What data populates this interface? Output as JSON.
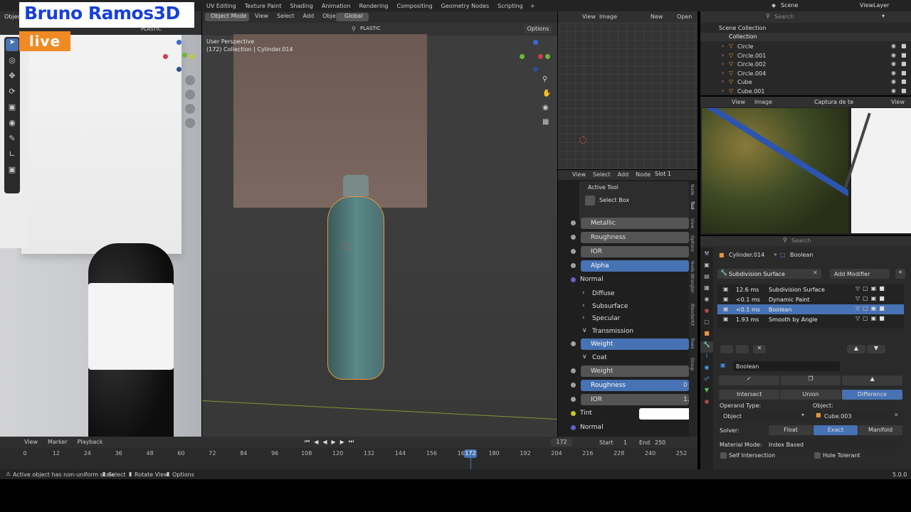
{
  "overlay": {
    "brand": "Bruno Ramos3D",
    "live": "live"
  },
  "topbar": {
    "workspaces": [
      "UV Editing",
      "Texture Paint",
      "Shading",
      "Animation",
      "Rendering",
      "Compositing",
      "Geometry Nodes",
      "Scripting"
    ],
    "add_tab": "+",
    "scene": "Scene",
    "view_layer": "ViewLayer"
  },
  "left_viewport": {
    "search_value": "PLASTIC",
    "tab": "Objec"
  },
  "main_viewport": {
    "mode": "Object Mode",
    "menus": [
      "View",
      "Select",
      "Add",
      "Object"
    ],
    "orientation": "Global",
    "search_value": "PLASTIC",
    "options": "Options",
    "info_line1": "User Perspective",
    "info_line2": "(172) Collection | Cylinder.014"
  },
  "image_editor_top": {
    "menus": [
      "View",
      "Image"
    ],
    "new": "New",
    "open": "Open"
  },
  "node_editor": {
    "menus": [
      "View",
      "Select",
      "Add",
      "Node"
    ],
    "slot": "Slot 1",
    "active_tool_title": "Active Tool",
    "active_tool_name": "Select Box",
    "tabs": [
      "Node",
      "Tool",
      "View",
      "Options",
      "Node Wrangler",
      "BlenderKit",
      "Trees",
      "Group"
    ],
    "rows": [
      {
        "label": "Metallic",
        "type": "field",
        "socket": "#a1a1a1"
      },
      {
        "label": "Roughness",
        "type": "field",
        "socket": "#a1a1a1"
      },
      {
        "label": "IOR",
        "type": "field",
        "socket": "#a1a1a1"
      },
      {
        "label": "Alpha",
        "type": "blue",
        "socket": "#a1a1a1"
      },
      {
        "label": "Normal",
        "type": "plain",
        "socket": "#6363c7"
      },
      {
        "label": "Diffuse",
        "type": "section"
      },
      {
        "label": "Subsurface",
        "type": "section"
      },
      {
        "label": "Specular",
        "type": "section"
      },
      {
        "label": "Transmission",
        "type": "section-open"
      },
      {
        "label": "Weight",
        "type": "blue",
        "socket": "#a1a1a1"
      },
      {
        "label": "Coat",
        "type": "section-open"
      },
      {
        "label": "Weight",
        "type": "field",
        "socket": "#a1a1a1"
      },
      {
        "label": "Roughness",
        "type": "blue",
        "socket": "#a1a1a1",
        "value": "0"
      },
      {
        "label": "IOR",
        "type": "field",
        "socket": "#a1a1a1",
        "value": "1."
      },
      {
        "label": "Tint",
        "type": "color",
        "socket": "#c7c729"
      },
      {
        "label": "Normal",
        "type": "plain",
        "socket": "#6363c7"
      }
    ]
  },
  "outliner": {
    "search_placeholder": "Search",
    "scene_collection": "Scene Collection",
    "collection": "Collection",
    "items": [
      "Circle",
      "Circle.001",
      "Circle.002",
      "Circle.004",
      "Cube",
      "Cube.001"
    ]
  },
  "image_editor_bottom": {
    "menus": [
      "View",
      "Image"
    ],
    "image_name": "Captura de te",
    "view2": "View"
  },
  "properties": {
    "search_placeholder": "Search",
    "object": "Cylinder.014",
    "modifier_context": "Boolean",
    "subdivision_title": "Subdivision Surface",
    "add_modifier": "Add Modifier",
    "modifiers": [
      {
        "time": "12.6 ms",
        "name": "Subdivision Surface",
        "selected": false
      },
      {
        "time": "<0.1 ms",
        "name": "Dynamic Paint",
        "selected": false
      },
      {
        "time": "<0.1 ms",
        "name": "Boolean",
        "selected": true
      },
      {
        "time": "1.93 ms",
        "name": "Smooth by Angle",
        "selected": false
      }
    ],
    "boolean_name": "Boolean",
    "ops": [
      "Intersect",
      "Union",
      "Difference"
    ],
    "operand_type_label": "Operand Type:",
    "operand_type_value": "Object",
    "object_label": "Object:",
    "object_value": "Cube.003",
    "solver_label": "Solver:",
    "solvers": [
      "Float",
      "Exact",
      "Manifold"
    ],
    "material_mode_label": "Material Mode:",
    "material_mode_value": "Index Based",
    "self_intersection": "Self Intersection",
    "hole_tolerant": "Hole Tolerant"
  },
  "timeline": {
    "menus": [
      "View",
      "Marker",
      "Playback"
    ],
    "current_frame": "172",
    "start_label": "Start",
    "start": "1",
    "end_label": "End",
    "end": "250",
    "ticks": [
      "0",
      "12",
      "24",
      "36",
      "48",
      "60",
      "72",
      "84",
      "96",
      "108",
      "120",
      "132",
      "144",
      "156",
      "168",
      "180",
      "192",
      "204",
      "216",
      "228",
      "240",
      "252"
    ],
    "playhead": "172"
  },
  "statusbar": {
    "message": "Active object has non-uniform scale",
    "select": "Select",
    "rotate": "Rotate View",
    "options": "Options",
    "version": "5.0.0"
  },
  "colors": {
    "accent": "#4772b3",
    "selection": "#e8953c",
    "live": "#f08a24"
  }
}
